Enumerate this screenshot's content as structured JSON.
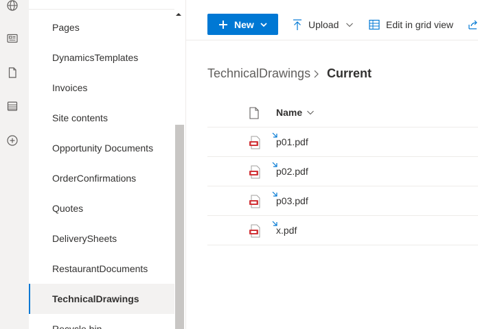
{
  "nav": {
    "items": [
      {
        "label": "Pages"
      },
      {
        "label": "DynamicsTemplates"
      },
      {
        "label": "Invoices"
      },
      {
        "label": "Site contents"
      },
      {
        "label": "Opportunity Documents"
      },
      {
        "label": "OrderConfirmations"
      },
      {
        "label": "Quotes"
      },
      {
        "label": "DeliverySheets"
      },
      {
        "label": "RestaurantDocuments"
      },
      {
        "label": "TechnicalDrawings"
      },
      {
        "label": "Recycle bin"
      }
    ],
    "selected": "TechnicalDrawings"
  },
  "rail": {
    "icons": [
      "globe-icon",
      "news-icon",
      "document-icon",
      "list-icon",
      "add-circle-icon"
    ]
  },
  "command_bar": {
    "new_label": "New",
    "upload_label": "Upload",
    "grid_label": "Edit in grid view"
  },
  "breadcrumb": {
    "parent": "TechnicalDrawings",
    "current": "Current"
  },
  "list": {
    "name_header": "Name",
    "files": [
      {
        "name": "p01.pdf"
      },
      {
        "name": "p02.pdf"
      },
      {
        "name": "p03.pdf"
      },
      {
        "name": "x.pdf"
      }
    ]
  },
  "colors": {
    "accent": "#0078d4",
    "pdf": "#d13438"
  }
}
